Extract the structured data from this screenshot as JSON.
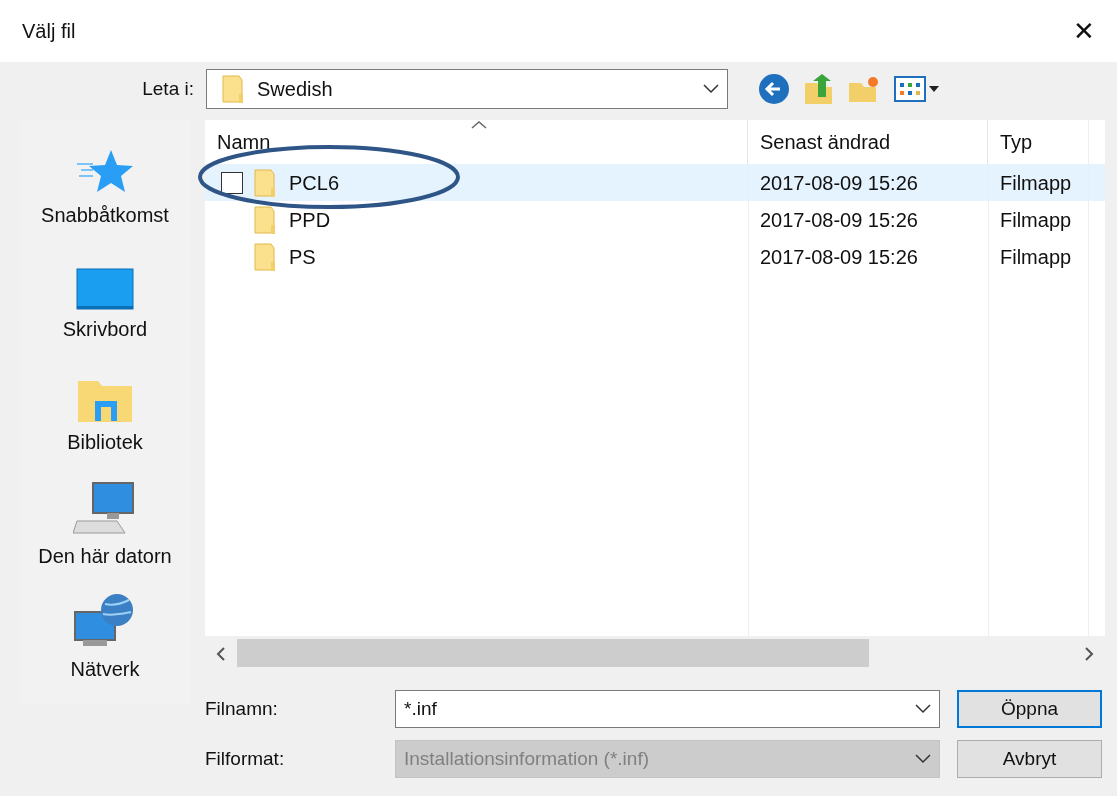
{
  "window": {
    "title": "Välj fil",
    "close": "✕"
  },
  "location": {
    "label": "Leta i:",
    "value": "Swedish"
  },
  "sidebar": {
    "items": [
      {
        "label": "Snabbåtkomst",
        "kind": "star"
      },
      {
        "label": "Skrivbord",
        "kind": "desktop"
      },
      {
        "label": "Bibliotek",
        "kind": "library"
      },
      {
        "label": "Den här datorn",
        "kind": "computer"
      },
      {
        "label": "Nätverk",
        "kind": "network"
      }
    ]
  },
  "table": {
    "columns": [
      "Namn",
      "Senast ändrad",
      "Typ"
    ],
    "rows": [
      {
        "name": "PCL6",
        "modified": "2017-08-09 15:26",
        "type": "Filmapp",
        "selected": true,
        "checked": false
      },
      {
        "name": "PPD",
        "modified": "2017-08-09 15:26",
        "type": "Filmapp",
        "selected": false,
        "checked": false
      },
      {
        "name": "PS",
        "modified": "2017-08-09 15:26",
        "type": "Filmapp",
        "selected": false,
        "checked": false
      }
    ]
  },
  "filename": {
    "label": "Filnamn:",
    "value": "*.inf"
  },
  "filetype": {
    "label": "Filformat:",
    "value": "Installationsinformation (*.inf)",
    "disabled": true
  },
  "buttons": [
    {
      "label": "Öppna",
      "default": true
    },
    {
      "label": "Avbryt",
      "default": false
    }
  ]
}
